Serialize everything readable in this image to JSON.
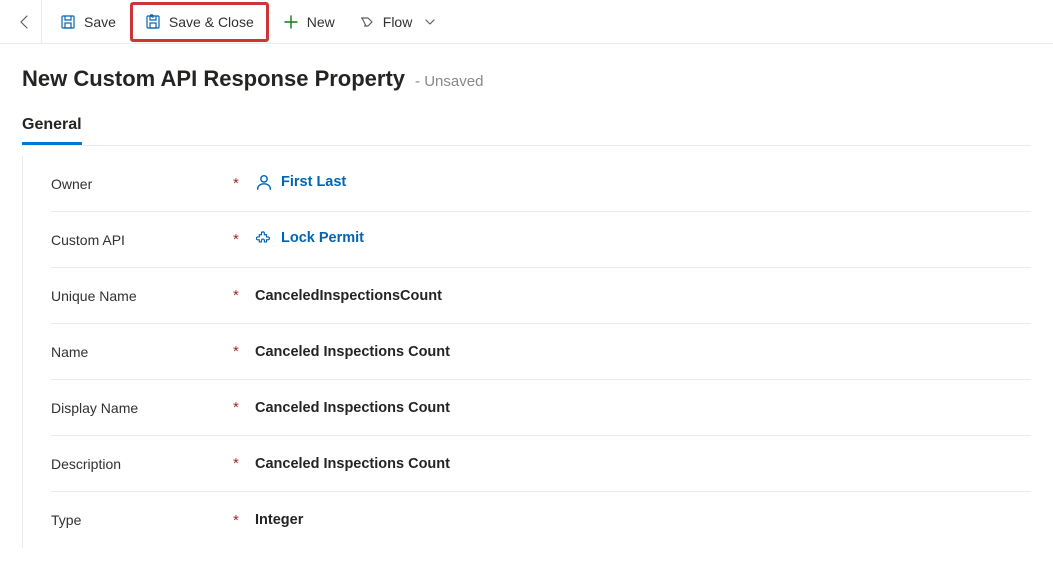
{
  "toolbar": {
    "save_label": "Save",
    "save_close_label": "Save & Close",
    "new_label": "New",
    "flow_label": "Flow"
  },
  "header": {
    "title": "New Custom API Response Property",
    "status": "- Unsaved"
  },
  "tabs": {
    "general": "General"
  },
  "form": {
    "owner": {
      "label": "Owner",
      "value": "First Last"
    },
    "custom_api": {
      "label": "Custom API",
      "value": "Lock Permit"
    },
    "unique_name": {
      "label": "Unique Name",
      "value": "CanceledInspectionsCount"
    },
    "name": {
      "label": "Name",
      "value": "Canceled Inspections Count"
    },
    "display_name": {
      "label": "Display Name",
      "value": "Canceled Inspections Count"
    },
    "description": {
      "label": "Description",
      "value": "Canceled Inspections Count"
    },
    "type": {
      "label": "Type",
      "value": "Integer"
    }
  }
}
